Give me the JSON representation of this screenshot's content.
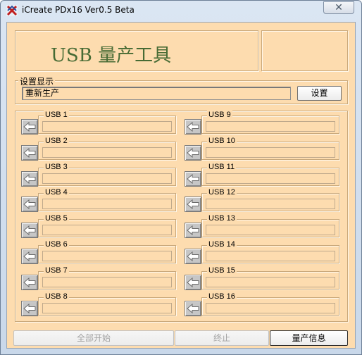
{
  "window": {
    "title": "iCreate PDx16 Ver0.5 Beta",
    "close_label": "✕"
  },
  "header": {
    "title": "USB 量产工具"
  },
  "settings": {
    "group_label": "设置显示",
    "field_value": "重新生产",
    "button_label": "设置"
  },
  "usb_slots": [
    {
      "label": "USB 1",
      "progress": 0
    },
    {
      "label": "USB 2",
      "progress": 0
    },
    {
      "label": "USB 3",
      "progress": 0
    },
    {
      "label": "USB 4",
      "progress": 0
    },
    {
      "label": "USB 5",
      "progress": 0
    },
    {
      "label": "USB 6",
      "progress": 0
    },
    {
      "label": "USB 7",
      "progress": 0
    },
    {
      "label": "USB 8",
      "progress": 0
    },
    {
      "label": "USB 9",
      "progress": 0
    },
    {
      "label": "USB 10",
      "progress": 0
    },
    {
      "label": "USB 11",
      "progress": 0
    },
    {
      "label": "USB 12",
      "progress": 0
    },
    {
      "label": "USB 13",
      "progress": 0
    },
    {
      "label": "USB 14",
      "progress": 0
    },
    {
      "label": "USB 15",
      "progress": 0
    },
    {
      "label": "USB 16",
      "progress": 0
    }
  ],
  "slot_icon": "left-arrow-icon",
  "buttons": {
    "start_all": "全部开始",
    "stop": "终止",
    "production_info": "量产信息"
  },
  "colors": {
    "background": "#fddcaf",
    "title_text": "#476b34"
  }
}
